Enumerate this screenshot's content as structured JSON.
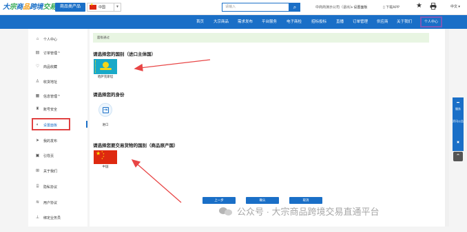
{
  "topbar": {
    "logo_text": "大宗商品跨境交易",
    "category_button": "商品类产品",
    "country_selected": "中国",
    "search_placeholder": "请输入",
    "user_info": "中商商演示公司（退出）",
    "settings_label": "设置面板",
    "app_label": "下载APP",
    "language": "中文"
  },
  "nav": {
    "items": [
      "首页",
      "大宗商品",
      "需求发布",
      "平台服务",
      "电子商检",
      "招标投标",
      "直播",
      "订单管理",
      "供应商",
      "关于我们"
    ],
    "active": "个人中心"
  },
  "sidebar": {
    "items": [
      {
        "label": "个人中心",
        "icon": "home-icon"
      },
      {
        "label": "订单管理 ^",
        "icon": "document-icon"
      },
      {
        "label": "商品收藏",
        "icon": "heart-icon"
      },
      {
        "label": "收货地址",
        "icon": "user-icon"
      },
      {
        "label": "信息管理 ^",
        "icon": "calendar-icon"
      },
      {
        "label": "账号安全",
        "icon": "shield-icon"
      },
      {
        "label": "设置面板",
        "icon": "toggle-icon"
      },
      {
        "label": "我的发布",
        "icon": "send-icon"
      },
      {
        "label": "引导页",
        "icon": "guide-icon"
      },
      {
        "label": "关于我们",
        "icon": "info-icon"
      },
      {
        "label": "隐私协议",
        "icon": "lock-icon"
      },
      {
        "label": "用户协议",
        "icon": "agreement-icon"
      },
      {
        "label": "绑定业务员",
        "icon": "bind-icon"
      }
    ]
  },
  "main": {
    "notice": "面板通过",
    "section1_title": "请选择您的国别（进口主体国）",
    "country1_label": "哈萨克斯坦",
    "section2_title": "请选择您的身份",
    "identity_label": "进口",
    "section3_title": "请选择您要交易货物的国别（商品原产国）",
    "country2_label": "中国",
    "buttons": {
      "prev": "上一步",
      "confirm": "确认",
      "cancel": "取消"
    }
  },
  "floatbar": {
    "item1": "服务",
    "item2": "资讯公告"
  },
  "watermark": "公众号 · 大宗商品跨境交易直通平台",
  "colors": {
    "primary": "#1a6fc7",
    "highlight": "#e04040",
    "active_nav_border": "#7a5ab8"
  }
}
